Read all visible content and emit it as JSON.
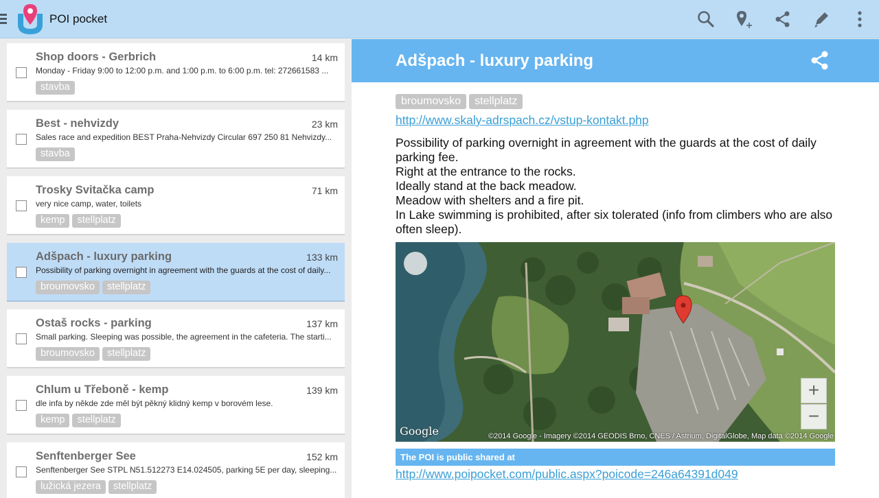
{
  "app": {
    "title": "POI pocket",
    "accent": "#66b5f0",
    "actionbar_color": "#bcdcf6"
  },
  "actionbar": {
    "icons": [
      "search-icon",
      "add-place-icon",
      "share-icon",
      "edit-icon",
      "overflow-menu-icon"
    ]
  },
  "list": {
    "items": [
      {
        "title": "Shop doors - Gerbrich",
        "distance": "14 km",
        "description": "Monday - Friday  9:00 to 12:00 p.m. and 1:00 p.m. to 6:00 p.m.  tel: 272661583 ...",
        "tags": [
          "stavba"
        ],
        "selected": false
      },
      {
        "title": "Best - nehvizdy",
        "distance": "23 km",
        "description": "Sales race and expedition BEST Praha-Nehvizdy   Circular 697  250 81 Nehvizdy...",
        "tags": [
          "stavba"
        ],
        "selected": false
      },
      {
        "title": "Trosky Svitačka camp",
        "distance": "71 km",
        "description": "very nice camp, water, toilets",
        "tags": [
          "kemp",
          "stellplatz"
        ],
        "selected": false
      },
      {
        "title": "Adšpach - luxury parking",
        "distance": "133 km",
        "description": "Possibility of parking overnight in agreement with the guards at the cost of daily...",
        "tags": [
          "broumovsko",
          "stellplatz"
        ],
        "selected": true
      },
      {
        "title": "Ostaš rocks - parking",
        "distance": "137 km",
        "description": "Small parking.  Sleeping was possible, the agreement in the cafeteria.  The starti...",
        "tags": [
          "broumovsko",
          "stellplatz"
        ],
        "selected": false
      },
      {
        "title": "Chlum u Třeboně - kemp",
        "distance": "139 km",
        "description": "dle infa by někde zde měl být pěkný klidný kemp v borovém lese.",
        "tags": [
          "kemp",
          "stellplatz"
        ],
        "selected": false
      },
      {
        "title": "Senftenberger See",
        "distance": "152 km",
        "description": "Senftenberger See STPL N51.512273 E14.024505, parking 5E per day, sleeping...",
        "tags": [
          "lužická jezera",
          "stellplatz"
        ],
        "selected": false
      }
    ]
  },
  "detail": {
    "title": "Adšpach - luxury parking",
    "tags": [
      "broumovsko",
      "stellplatz"
    ],
    "url": "http://www.skaly-adrspach.cz/vstup-kontakt.php",
    "description_lines": [
      "Possibility of parking overnight in agreement with the guards at the cost of daily parking fee.",
      "Right at the entrance to the rocks.",
      "Ideally stand at the back meadow.",
      "Meadow with shelters and a fire pit.",
      "In Lake swimming is prohibited, after six tolerated (info from climbers who are also often sleep)."
    ],
    "map": {
      "zoom_in": "+",
      "zoom_out": "−",
      "copyright": "©2014 Google - Imagery ©2014 GEODIS Brno, CNES / Astrium, DigitalGlobe, Map data ©2014 Google",
      "logo": "Google"
    },
    "shared_label": "The POI is public shared at",
    "shared_url": "http://www.poipocket.com/public.aspx?poicode=246a64391d049"
  }
}
